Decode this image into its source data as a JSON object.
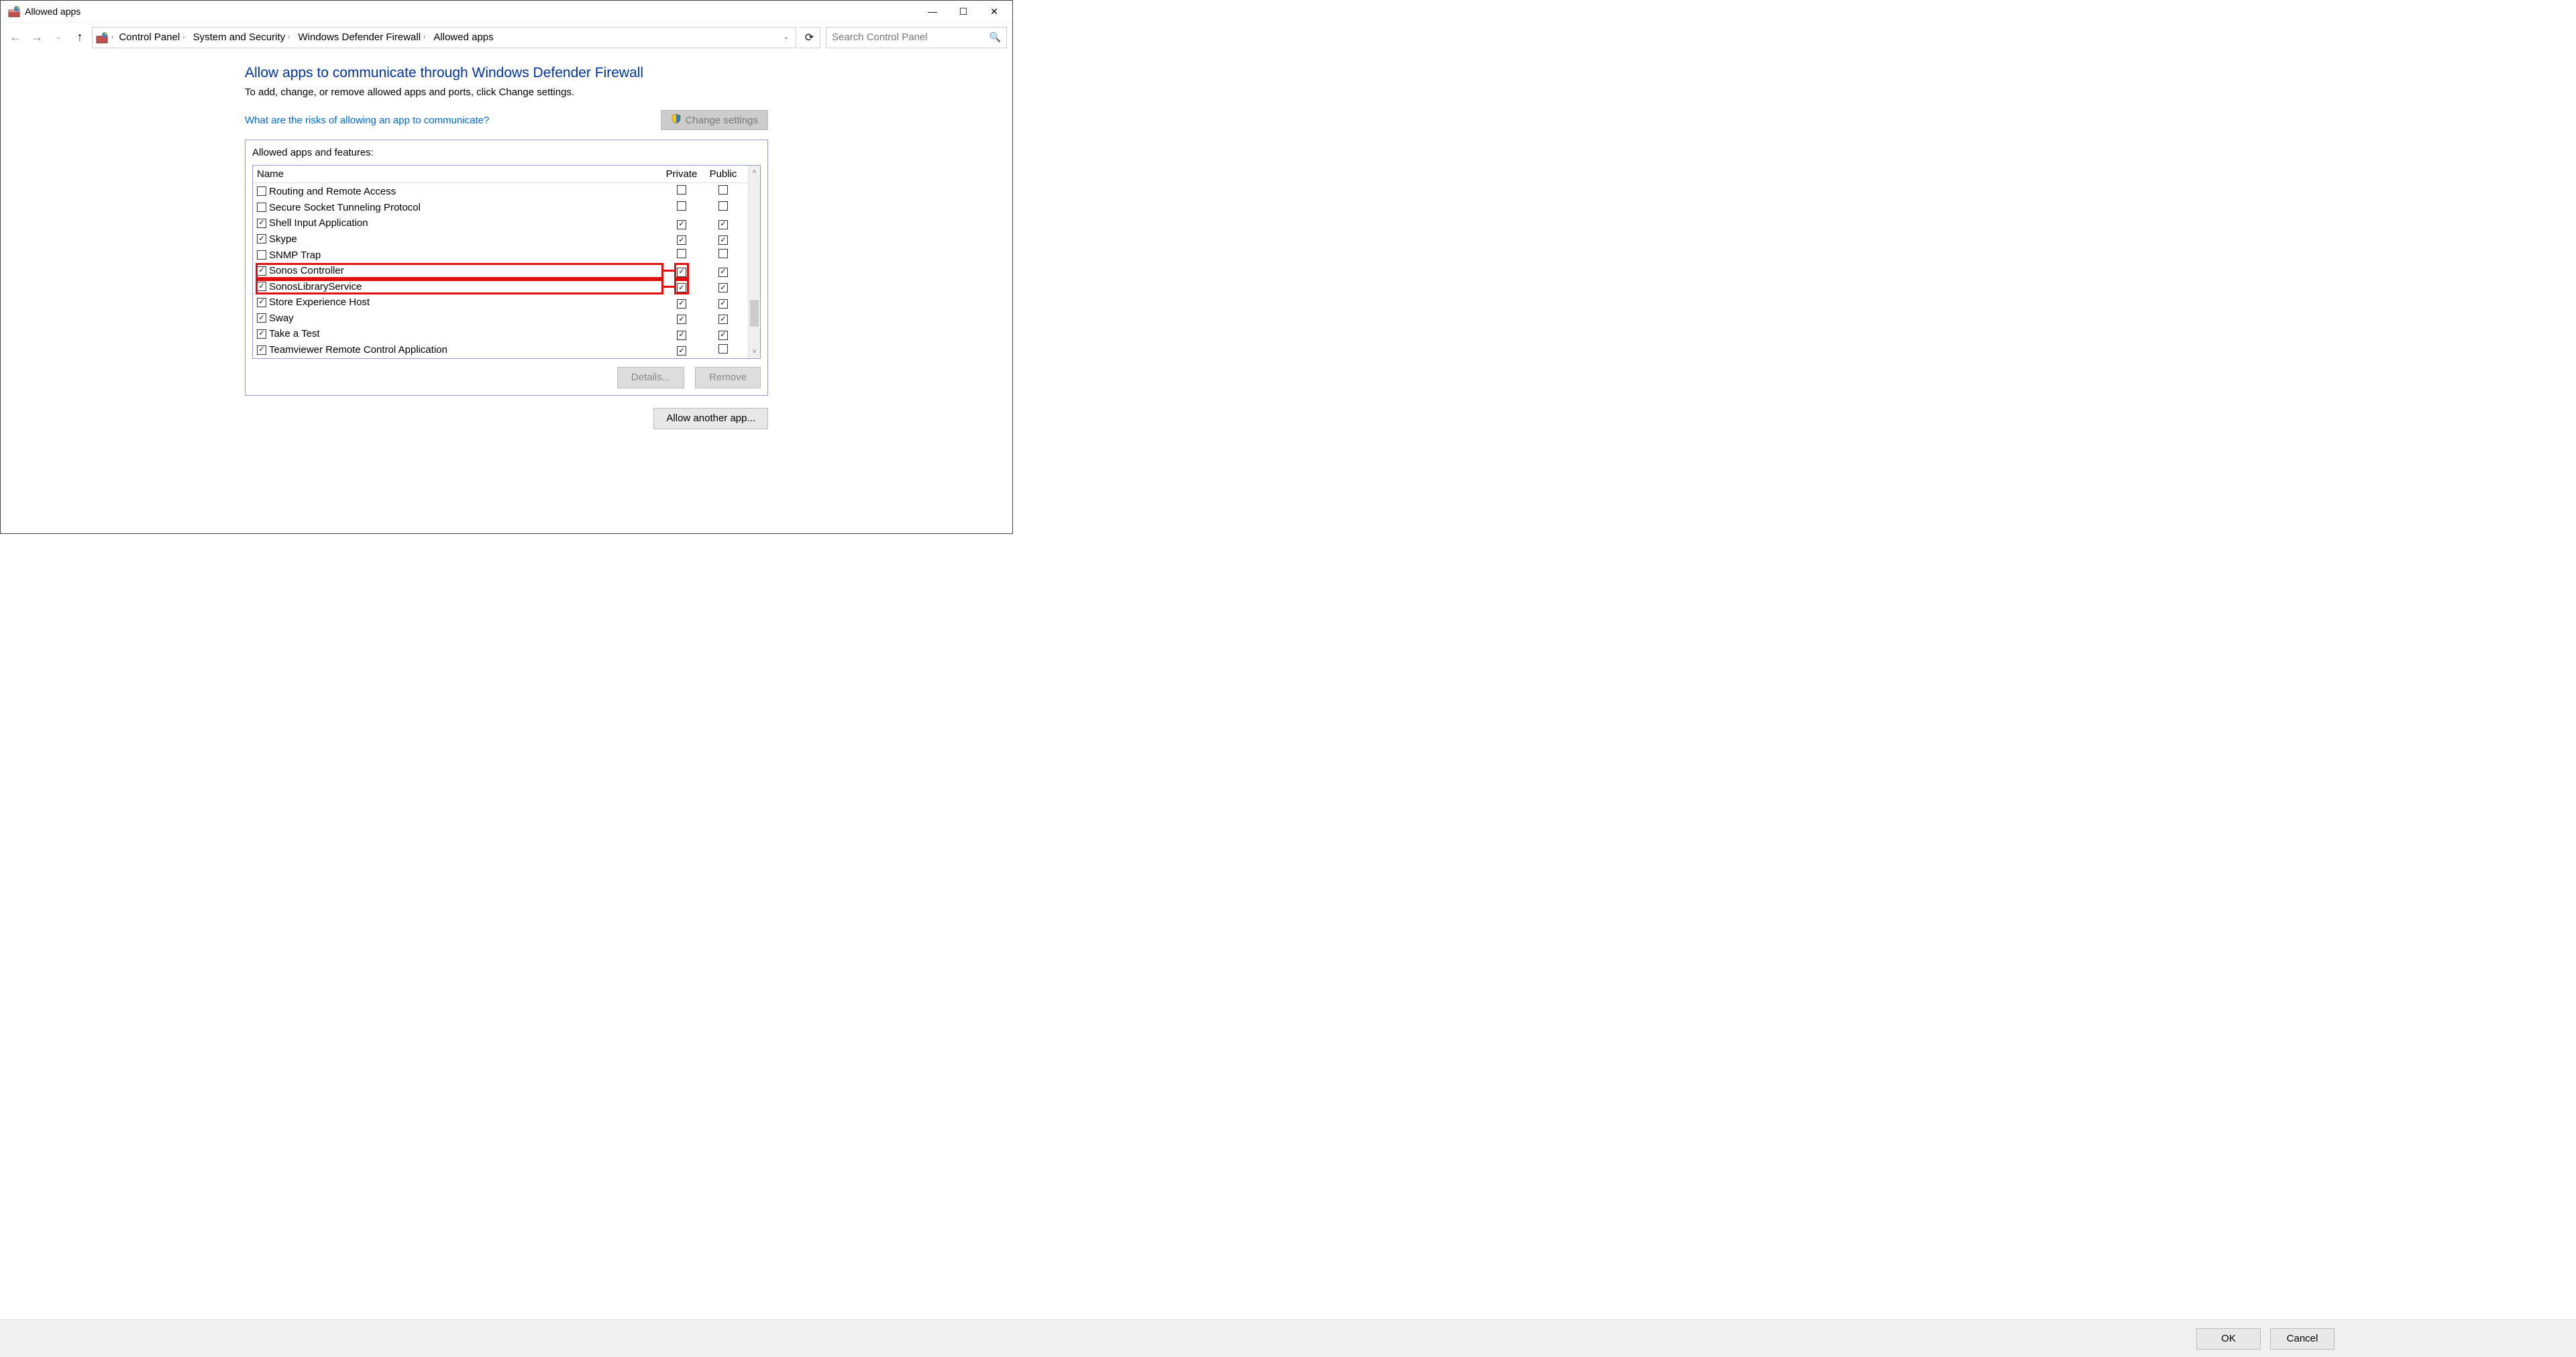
{
  "window": {
    "title": "Allowed apps",
    "minimize": "—",
    "maximize": "☐",
    "close": "✕"
  },
  "nav": {
    "back": "←",
    "forward": "→",
    "up": "↑",
    "refresh": "⟳"
  },
  "breadcrumbs": [
    "Control Panel",
    "System and Security",
    "Windows Defender Firewall",
    "Allowed apps"
  ],
  "search": {
    "placeholder": "Search Control Panel"
  },
  "main": {
    "heading": "Allow apps to communicate through Windows Defender Firewall",
    "subtext": "To add, change, or remove allowed apps and ports, click Change settings.",
    "risks_link": "What are the risks of allowing an app to communicate?",
    "change_settings": "Change settings",
    "group_label": "Allowed apps and features:",
    "columns": {
      "name": "Name",
      "private": "Private",
      "public": "Public"
    },
    "rows": [
      {
        "enabled": false,
        "name": "Routing and Remote Access",
        "private": false,
        "public": false,
        "highlighted": false
      },
      {
        "enabled": false,
        "name": "Secure Socket Tunneling Protocol",
        "private": false,
        "public": false,
        "highlighted": false
      },
      {
        "enabled": true,
        "name": "Shell Input Application",
        "private": true,
        "public": true,
        "highlighted": false
      },
      {
        "enabled": true,
        "name": "Skype",
        "private": true,
        "public": true,
        "highlighted": false
      },
      {
        "enabled": false,
        "name": "SNMP Trap",
        "private": false,
        "public": false,
        "highlighted": false
      },
      {
        "enabled": true,
        "name": "Sonos Controller",
        "private": true,
        "public": true,
        "highlighted": true
      },
      {
        "enabled": true,
        "name": "SonosLibraryService",
        "private": true,
        "public": true,
        "highlighted": true
      },
      {
        "enabled": true,
        "name": "Store Experience Host",
        "private": true,
        "public": true,
        "highlighted": false
      },
      {
        "enabled": true,
        "name": "Sway",
        "private": true,
        "public": true,
        "highlighted": false
      },
      {
        "enabled": true,
        "name": "Take a Test",
        "private": true,
        "public": true,
        "highlighted": false
      },
      {
        "enabled": true,
        "name": "Teamviewer Remote Control Application",
        "private": true,
        "public": false,
        "highlighted": false
      }
    ],
    "details": "Details...",
    "remove": "Remove",
    "allow_another": "Allow another app..."
  },
  "footer": {
    "ok": "OK",
    "cancel": "Cancel"
  }
}
